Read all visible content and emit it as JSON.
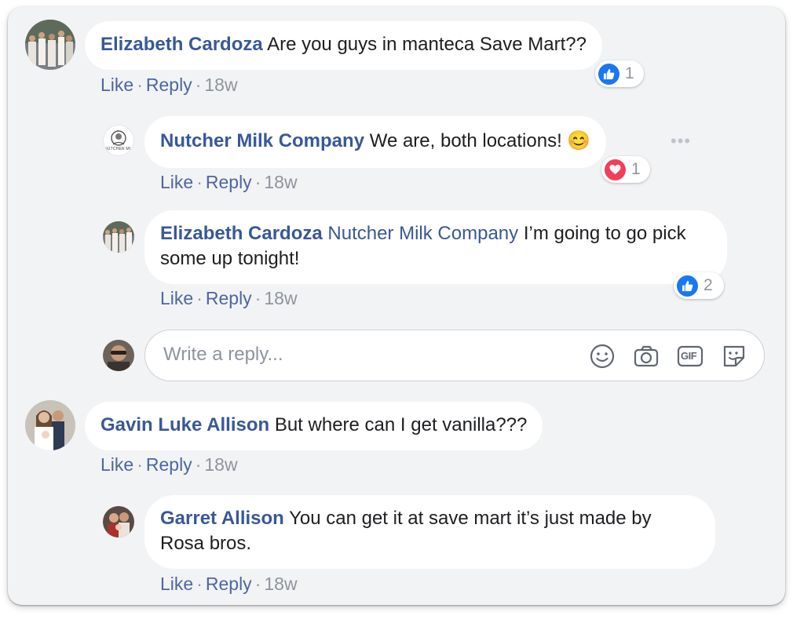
{
  "comments": [
    {
      "author": "Elizabeth Cardoza",
      "text": "Are you guys in manteca Save Mart??",
      "reaction_type": "like",
      "reaction_count": "1",
      "like": "Like",
      "reply": "Reply",
      "time": "18w"
    },
    {
      "author": "Nutcher Milk Company",
      "text": "We are, both locations!",
      "emoji": "😊",
      "reaction_type": "love",
      "reaction_count": "1",
      "avatar_text": "NUTCHER MI",
      "like": "Like",
      "reply": "Reply",
      "time": "18w"
    },
    {
      "author": "Elizabeth Cardoza",
      "mention": "Nutcher Milk Company",
      "text": "I’m going to go pick some up tonight!",
      "reaction_type": "like",
      "reaction_count": "2",
      "like": "Like",
      "reply": "Reply",
      "time": "18w"
    },
    {
      "author": "Gavin Luke Allison",
      "text": "But where can I get vanilla???",
      "like": "Like",
      "reply": "Reply",
      "time": "18w"
    },
    {
      "author": "Garret Allison",
      "text": "You can get it at save mart it’s just made by Rosa bros.",
      "like": "Like",
      "reply": "Reply",
      "time": "18w"
    }
  ],
  "reply_box": {
    "placeholder": "Write a reply...",
    "gif_label": "GIF"
  },
  "colors": {
    "link": "#385898",
    "like_blue": "#1877f2",
    "love_red": "#f33e58",
    "background": "#f2f3f5"
  }
}
